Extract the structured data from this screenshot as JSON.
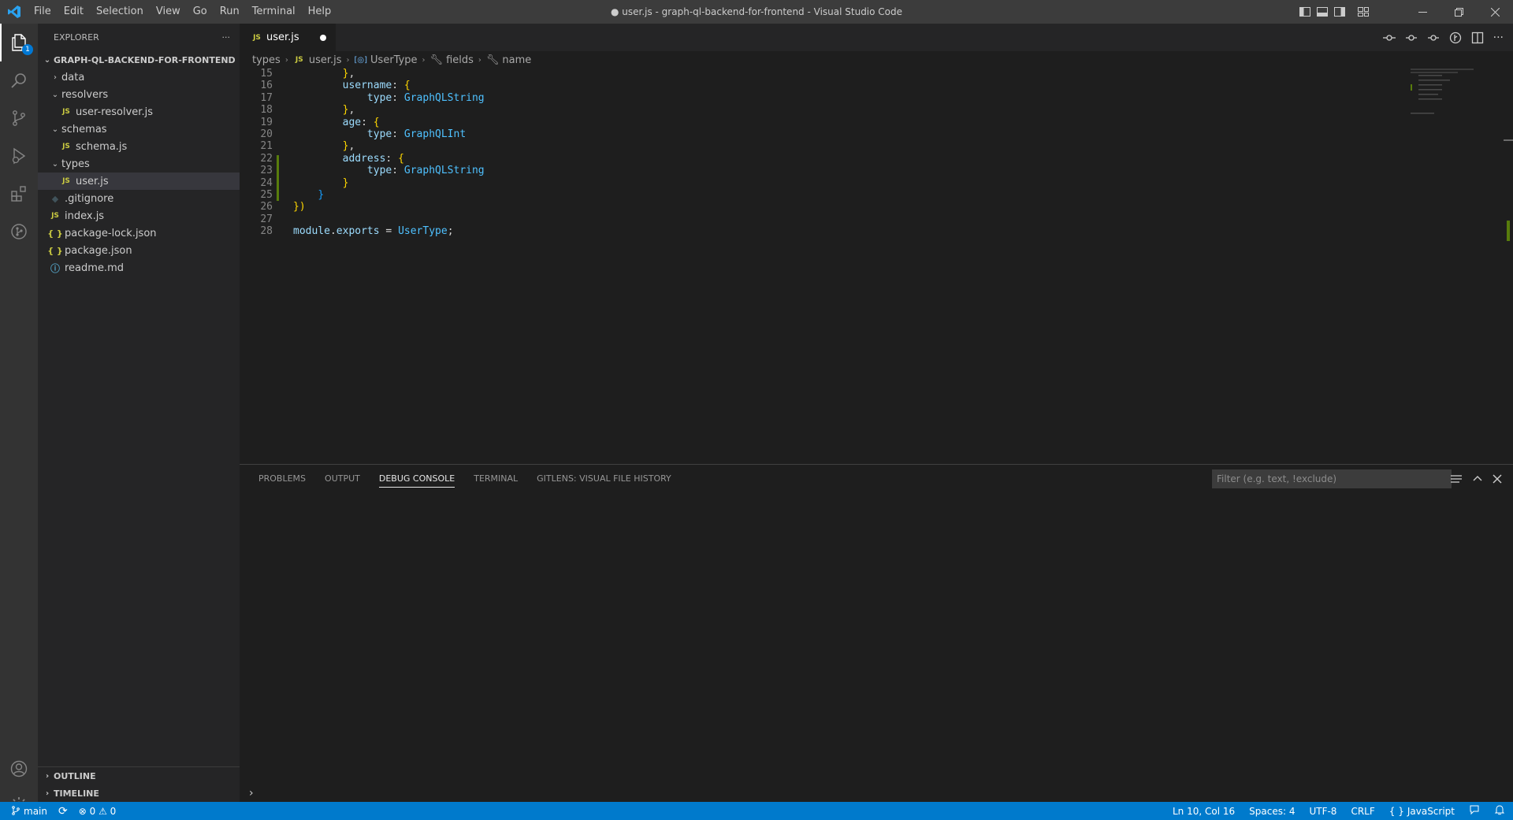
{
  "window": {
    "title": "● user.js - graph-ql-backend-for-frontend - Visual Studio Code",
    "menu": [
      "File",
      "Edit",
      "Selection",
      "View",
      "Go",
      "Run",
      "Terminal",
      "Help"
    ]
  },
  "activity_bar": {
    "explorer_badge": "1"
  },
  "sidebar": {
    "header": "EXPLORER",
    "more": "···",
    "root": "GRAPH-QL-BACKEND-FOR-FRONTEND",
    "tree": [
      {
        "label": "data",
        "kind": "folder",
        "expanded": false,
        "depth": 1
      },
      {
        "label": "resolvers",
        "kind": "folder",
        "expanded": true,
        "depth": 1
      },
      {
        "label": "user-resolver.js",
        "kind": "js",
        "depth": 2
      },
      {
        "label": "schemas",
        "kind": "folder",
        "expanded": true,
        "depth": 1
      },
      {
        "label": "schema.js",
        "kind": "js",
        "depth": 2
      },
      {
        "label": "types",
        "kind": "folder",
        "expanded": true,
        "depth": 1
      },
      {
        "label": "user.js",
        "kind": "js",
        "depth": 2,
        "selected": true
      },
      {
        "label": ".gitignore",
        "kind": "git",
        "depth": 1
      },
      {
        "label": "index.js",
        "kind": "js",
        "depth": 1
      },
      {
        "label": "package-lock.json",
        "kind": "json",
        "depth": 1
      },
      {
        "label": "package.json",
        "kind": "json",
        "depth": 1
      },
      {
        "label": "readme.md",
        "kind": "info",
        "depth": 1
      }
    ],
    "outline_label": "OUTLINE",
    "timeline_label": "TIMELINE"
  },
  "editor": {
    "tab_label": "user.js",
    "tab_icon": "JS",
    "breadcrumb": [
      "types",
      "user.js",
      "UserType",
      "fields",
      "name"
    ],
    "lines": [
      {
        "n": "15",
        "text": "        },"
      },
      {
        "n": "16",
        "text": "        username: {"
      },
      {
        "n": "17",
        "text": "            type: GraphQLString"
      },
      {
        "n": "18",
        "text": "        },"
      },
      {
        "n": "19",
        "text": "        age: {"
      },
      {
        "n": "20",
        "text": "            type: GraphQLInt"
      },
      {
        "n": "21",
        "text": "        },"
      },
      {
        "n": "22",
        "text": "        address: {"
      },
      {
        "n": "23",
        "text": "            type: GraphQLString"
      },
      {
        "n": "24",
        "text": "        }"
      },
      {
        "n": "25",
        "text": "    }"
      },
      {
        "n": "26",
        "text": "})"
      },
      {
        "n": "27",
        "text": ""
      },
      {
        "n": "28",
        "text": "module.exports = UserType;"
      }
    ]
  },
  "panel": {
    "tabs": [
      "PROBLEMS",
      "OUTPUT",
      "DEBUG CONSOLE",
      "TERMINAL",
      "GITLENS: VISUAL FILE HISTORY"
    ],
    "active_tab": "DEBUG CONSOLE",
    "filter_placeholder": "Filter (e.g. text, !exclude)",
    "prompt": "›"
  },
  "status_bar": {
    "branch": "main",
    "errors": "0",
    "warnings": "0",
    "position": "Ln 10, Col 16",
    "spaces": "Spaces: 4",
    "encoding": "UTF-8",
    "eol": "CRLF",
    "language": "JavaScript",
    "color": "#007acc"
  },
  "colors": {
    "accent": "#007acc",
    "js_icon": "#cbcb41",
    "git_added": "#587c0c"
  }
}
